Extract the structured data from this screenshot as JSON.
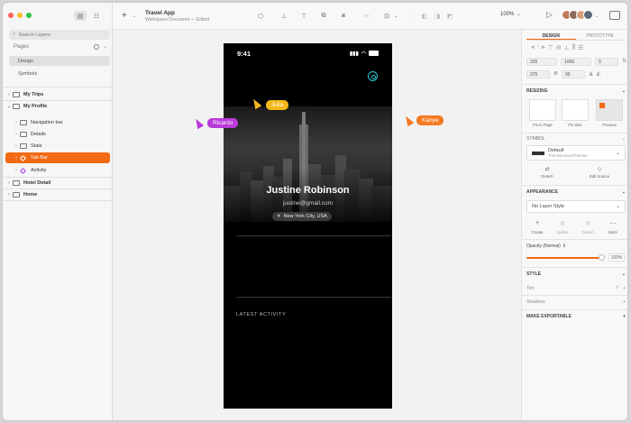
{
  "window": {
    "title": "Travel App",
    "subtitle": "Workspace Document — Edited"
  },
  "sidebar": {
    "search_placeholder": "Search Layers",
    "pages_label": "Pages",
    "pages": [
      {
        "label": "Design",
        "selected": true
      },
      {
        "label": "Symbols",
        "selected": false
      }
    ],
    "layers": [
      {
        "label": "My Trips",
        "bold": true,
        "indent": 0,
        "icon": "artboard"
      },
      {
        "label": "My Profile",
        "bold": true,
        "indent": 0,
        "icon": "artboard",
        "expanded": true
      },
      {
        "label": "Navigation bar",
        "bold": false,
        "indent": 1,
        "icon": "folder"
      },
      {
        "label": "Details",
        "bold": false,
        "indent": 1,
        "icon": "folder"
      },
      {
        "label": "Stats",
        "bold": false,
        "indent": 1,
        "icon": "folder"
      },
      {
        "label": "Tab Bar",
        "bold": false,
        "indent": 1,
        "icon": "symbol",
        "active": true
      },
      {
        "label": "Activity",
        "bold": false,
        "indent": 1,
        "icon": "symbol"
      },
      {
        "label": "Hotel Detail",
        "bold": true,
        "indent": 0,
        "icon": "artboard"
      },
      {
        "label": "Home",
        "bold": true,
        "indent": 0,
        "icon": "artboard"
      }
    ]
  },
  "toolbar": {
    "zoom": "100%"
  },
  "phone": {
    "time": "9:41",
    "name": "Justine Robinson",
    "email": "justine@gmail.com",
    "location": "New York City, USA",
    "activity_label": "LATEST ACTIVITY"
  },
  "collaborators": [
    {
      "name": "Julia",
      "color": "#f5b81c"
    },
    {
      "name": "Ricardo",
      "color": "#b83bd9"
    },
    {
      "name": "Kanye",
      "color": "#f57a22"
    }
  ],
  "inspector": {
    "tabs": [
      "DESIGN",
      "PROTOTYPE"
    ],
    "x": "335",
    "y": "1006",
    "r": "0",
    "w": "375",
    "h": "95",
    "resizing_label": "RESIZING",
    "resizing_options": [
      "Fix to Page",
      "Fix Size",
      "Preview"
    ],
    "symbol_label": "SYMBOL",
    "symbol_name": "Default",
    "symbol_sub": "This Document/Tab Bar",
    "symbol_actions": [
      "Detach",
      "Edit Source"
    ],
    "appearance_label": "APPEARANCE",
    "layer_style": "No Layer Style",
    "style_actions": [
      "Create",
      "Update",
      "Detach",
      "More"
    ],
    "opacity_label": "Opacity (Normal)",
    "opacity_value": "100%",
    "style_label": "STYLE",
    "tint_label": "Tint",
    "shadows_label": "Shadows",
    "exportable_label": "MAKE EXPORTABLE"
  }
}
